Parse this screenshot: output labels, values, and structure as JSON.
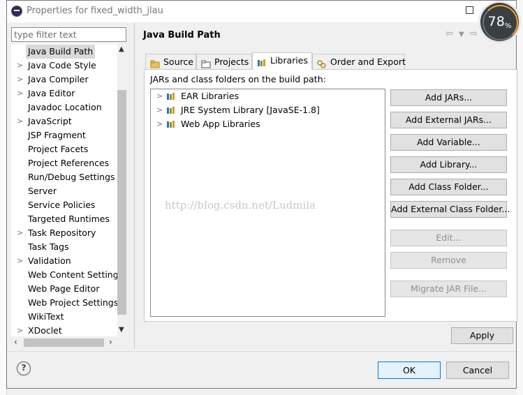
{
  "window": {
    "title": "Properties for fixed_width_jlau",
    "overlay_badge": {
      "value": "78",
      "unit": "%"
    }
  },
  "sidebar": {
    "filter_placeholder": "type filter text",
    "items": [
      {
        "label": "Java Build Path",
        "expandable": false,
        "selected": true
      },
      {
        "label": "Java Code Style",
        "expandable": true
      },
      {
        "label": "Java Compiler",
        "expandable": true
      },
      {
        "label": "Java Editor",
        "expandable": true
      },
      {
        "label": "Javadoc Location",
        "expandable": false
      },
      {
        "label": "JavaScript",
        "expandable": true
      },
      {
        "label": "JSP Fragment",
        "expandable": false
      },
      {
        "label": "Project Facets",
        "expandable": false
      },
      {
        "label": "Project References",
        "expandable": false
      },
      {
        "label": "Run/Debug Settings",
        "expandable": false
      },
      {
        "label": "Server",
        "expandable": false
      },
      {
        "label": "Service Policies",
        "expandable": false
      },
      {
        "label": "Targeted Runtimes",
        "expandable": false
      },
      {
        "label": "Task Repository",
        "expandable": true
      },
      {
        "label": "Task Tags",
        "expandable": false
      },
      {
        "label": "Validation",
        "expandable": true
      },
      {
        "label": "Web Content Settings",
        "expandable": false
      },
      {
        "label": "Web Page Editor",
        "expandable": false
      },
      {
        "label": "Web Project Settings",
        "expandable": false
      },
      {
        "label": "WikiText",
        "expandable": false
      },
      {
        "label": "XDoclet",
        "expandable": true
      }
    ]
  },
  "page": {
    "title": "Java Build Path",
    "tabs": [
      {
        "label": "Source",
        "icon": "source-folder-icon"
      },
      {
        "label": "Projects",
        "icon": "projects-icon"
      },
      {
        "label": "Libraries",
        "icon": "libraries-icon",
        "active": true
      },
      {
        "label": "Order and Export",
        "icon": "order-export-icon"
      }
    ],
    "content_label": "JARs and class folders on the build path:",
    "libraries": [
      {
        "label": "EAR Libraries"
      },
      {
        "label": "JRE System Library [JavaSE-1.8]"
      },
      {
        "label": "Web App Libraries"
      }
    ],
    "watermark": "http://blog.csdn.net/Ludmila",
    "buttons": [
      {
        "label": "Add JARs...",
        "enabled": true
      },
      {
        "label": "Add External JARs...",
        "enabled": true
      },
      {
        "label": "Add Variable...",
        "enabled": true
      },
      {
        "label": "Add Library...",
        "enabled": true
      },
      {
        "label": "Add Class Folder...",
        "enabled": true
      },
      {
        "label": "Add External Class Folder...",
        "enabled": true
      },
      {
        "label": "Edit...",
        "enabled": false
      },
      {
        "label": "Remove",
        "enabled": false
      },
      {
        "label": "Migrate JAR File...",
        "enabled": false
      }
    ],
    "apply_label": "Apply"
  },
  "footer": {
    "help_label": "?",
    "ok_label": "OK",
    "cancel_label": "Cancel"
  },
  "colors": {
    "selection_bg": "#d9d9d9",
    "ok_border": "#0078d7",
    "badge_bg": "#3a3e45",
    "badge_accent": "#f5a623"
  }
}
